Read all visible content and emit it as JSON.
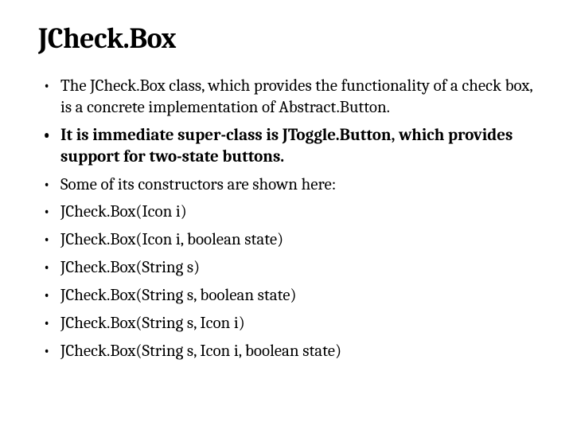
{
  "title": "JCheck.Box",
  "bullets": [
    {
      "text": "The JCheck.Box class, which provides the functionality of a check box, is a concrete implementation of Abstract.Button.",
      "bold": false
    },
    {
      "text": "It is immediate super-class is JToggle.Button, which provides support for two-state buttons.",
      "bold": true
    },
    {
      "text": "Some of its constructors are shown here:",
      "bold": false
    },
    {
      "text": "JCheck.Box(Icon i)",
      "bold": false
    },
    {
      "text": "JCheck.Box(Icon i, boolean state)",
      "bold": false
    },
    {
      "text": "JCheck.Box(String s)",
      "bold": false
    },
    {
      "text": "JCheck.Box(String s, boolean state)",
      "bold": false
    },
    {
      "text": "JCheck.Box(String s, Icon i)",
      "bold": false
    },
    {
      "text": "JCheck.Box(String s, Icon i, boolean state)",
      "bold": false
    }
  ]
}
